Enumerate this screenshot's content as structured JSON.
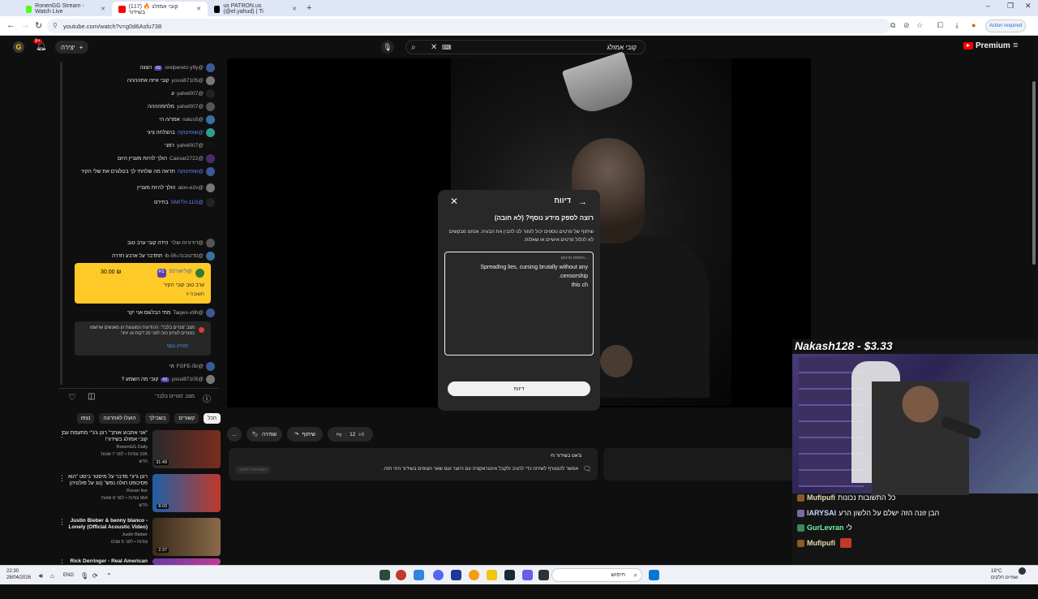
{
  "browser": {
    "tabs": [
      {
        "label": "RonenGG Stream - Watch Live",
        "active": false
      },
      {
        "label": "(117) קובי אמזלג 🔥 בשידור",
        "active": true
      },
      {
        "label": "us PATRON.us (@el.yahud) | Ti",
        "active": false
      }
    ],
    "url": "youtube.com/watch?v=g0d6Asfu738",
    "action_required": "Action required",
    "window_controls": [
      "–",
      "❐",
      "✕"
    ]
  },
  "youtube": {
    "create_label": "יצירה",
    "notif_count": "9+",
    "search_value": "קובי אמזלג",
    "logo_label": "Premium"
  },
  "chat": {
    "messages": [
      {
        "author": "@orelperetz-y9y",
        "text": "הצגה",
        "badge": "#2"
      },
      {
        "author": "@yossi87105",
        "text": "קובי איזה אתהההה"
      },
      {
        "author": "@yahel007",
        "text": "ע"
      },
      {
        "author": "@yahel007",
        "text": "מלחמהההה"
      },
      {
        "author": "@natus5",
        "text": "אמר/ה הי"
      },
      {
        "author": "@שופוקוקה",
        "text": "בהצלחה ציגי",
        "mod": true
      },
      {
        "author": "@yahel007",
        "text": "רמני"
      },
      {
        "author": "@Caesar2722",
        "text": "הולך להיות מעניין היום"
      },
      {
        "author": "@שופוקוקה",
        "text": "תראה מה שלחתי לך בטלגרם את שלי הקיר",
        "mod": true
      },
      {
        "author": "@alon-e2v",
        "text": "הולך להיות מעניין"
      },
      {
        "author": "@SMITH.11G",
        "text": "בחירם",
        "mod": true
      },
      {
        "author": "@דודורוח-שלר",
        "text": "הידה קובי ערב טוב"
      },
      {
        "author": "@סדטובנה-06-lb",
        "text": "תתדבר על ארבע חדרה"
      }
    ],
    "superchat": {
      "author": "@ליאור55",
      "badge": "#1",
      "amount": "30.00 ₪",
      "text": "ערב טוב קובי הקיר",
      "sub": "תשובה #"
    },
    "messages_after": [
      {
        "author": "@Taqwx-x9h",
        "text": "מתי הבלוגס אני יקר"
      }
    ],
    "mode_box": {
      "text": "מצב 'מנויים בלבד': ההודעות המוצגות הן מאנשים שרשמו כמנויים לערוץ הזה לפני 20 דקות או יותר.",
      "link": "למידע נוסף"
    },
    "messages_end": [
      {
        "author": "@FGFE-l5r",
        "text": "הי"
      },
      {
        "author": "@yossi87105",
        "text": "קובי מה השמע ?",
        "badge": "#2"
      }
    ],
    "input_placeholder": "מצב 'מנויים בלבד'"
  },
  "chips": [
    "הכל",
    "קשורים",
    "בשבילך",
    "הועלו לאחרונה",
    "נצפו"
  ],
  "recommendations": [
    {
      "title": "\"אני אתבוע אותך\" רונן ג'ג\"י מתעמת עם קובי אמזלג בשידור!",
      "channel": "RonenGG Daily",
      "stats": "10K צפיות • לפני 7 שעות",
      "duration": "31:49",
      "extra": "חדש"
    },
    {
      "title": "רונן ג'יג'י מדבר על מיסטר ביסט \"הוא פסיכופט חולה נפש\" (טנ על פולטיה)",
      "channel": "Ronen live",
      "stats": "964 צפיות • לפני 8 שעות",
      "duration": "8:03",
      "extra": "חדש"
    },
    {
      "title": "Justin Bieber & benny blanco - Lonely (Official Acoustic Video)",
      "channel": "Justin Bieber",
      "stats": "צפיות • לפני 5 שנים",
      "duration": "2:37",
      "extra": ""
    },
    {
      "title": "Rick Derringer - Real American",
      "channel": "",
      "stats": "",
      "duration": "",
      "extra": ""
    }
  ],
  "report_dialog": {
    "title": "דיווח",
    "question": "רוצה לספק מידע נוסף? (לא חובה)",
    "description": "שיתוף של פרטים נוספים יכול לעזור לנו להבין את הבעיה. אנחנו מבקשים לא לכלול פרטים אישיים או שאלות.",
    "placeholder": "הוספת פרטים...",
    "text_line1": "Spreading lies, cursing brutally without any",
    "text_line2": "censorship.",
    "text_line3": "this ch",
    "submit_label": "דיווח"
  },
  "actions": {
    "likes": "12",
    "share": "שיתוף",
    "save": "שמירה",
    "more": "..."
  },
  "info": {
    "line1": "צ'אט בשידור חי",
    "line2": "אפשר להצטרף לשיחה כדי להגיב ולקבל אינטראקציה עם היוצר ועם שאר הצופים בשידור החי הזה.",
    "btn": "הצטרפות לצ'אט"
  },
  "overlay": {
    "donation": "Nakash128 - $3.33",
    "twitch_chat": [
      {
        "name": "Mufipufi",
        "text": "כל התשובות נכונות",
        "color": "#e8d9b0"
      },
      {
        "name": "lARYSAl",
        "text": "הבן זונה הזה ישלם על הלשון הרע",
        "color": "#c7d6ff"
      },
      {
        "name": "GurLevran",
        "text": "לי",
        "color": "#6ff5a8"
      },
      {
        "name": "Mufipufi",
        "text": "",
        "color": "#e8d9b0"
      }
    ]
  },
  "taskbar": {
    "time": "22:30",
    "date": "28/04/2026",
    "lang": "ENG",
    "search": "חיפוש",
    "weather_temp": "19°C",
    "weather_desc": "שמיים חלקים"
  },
  "colors": {
    "accent": "#ff0000",
    "superchat": "#ffca28",
    "link": "#3ea6ff"
  }
}
